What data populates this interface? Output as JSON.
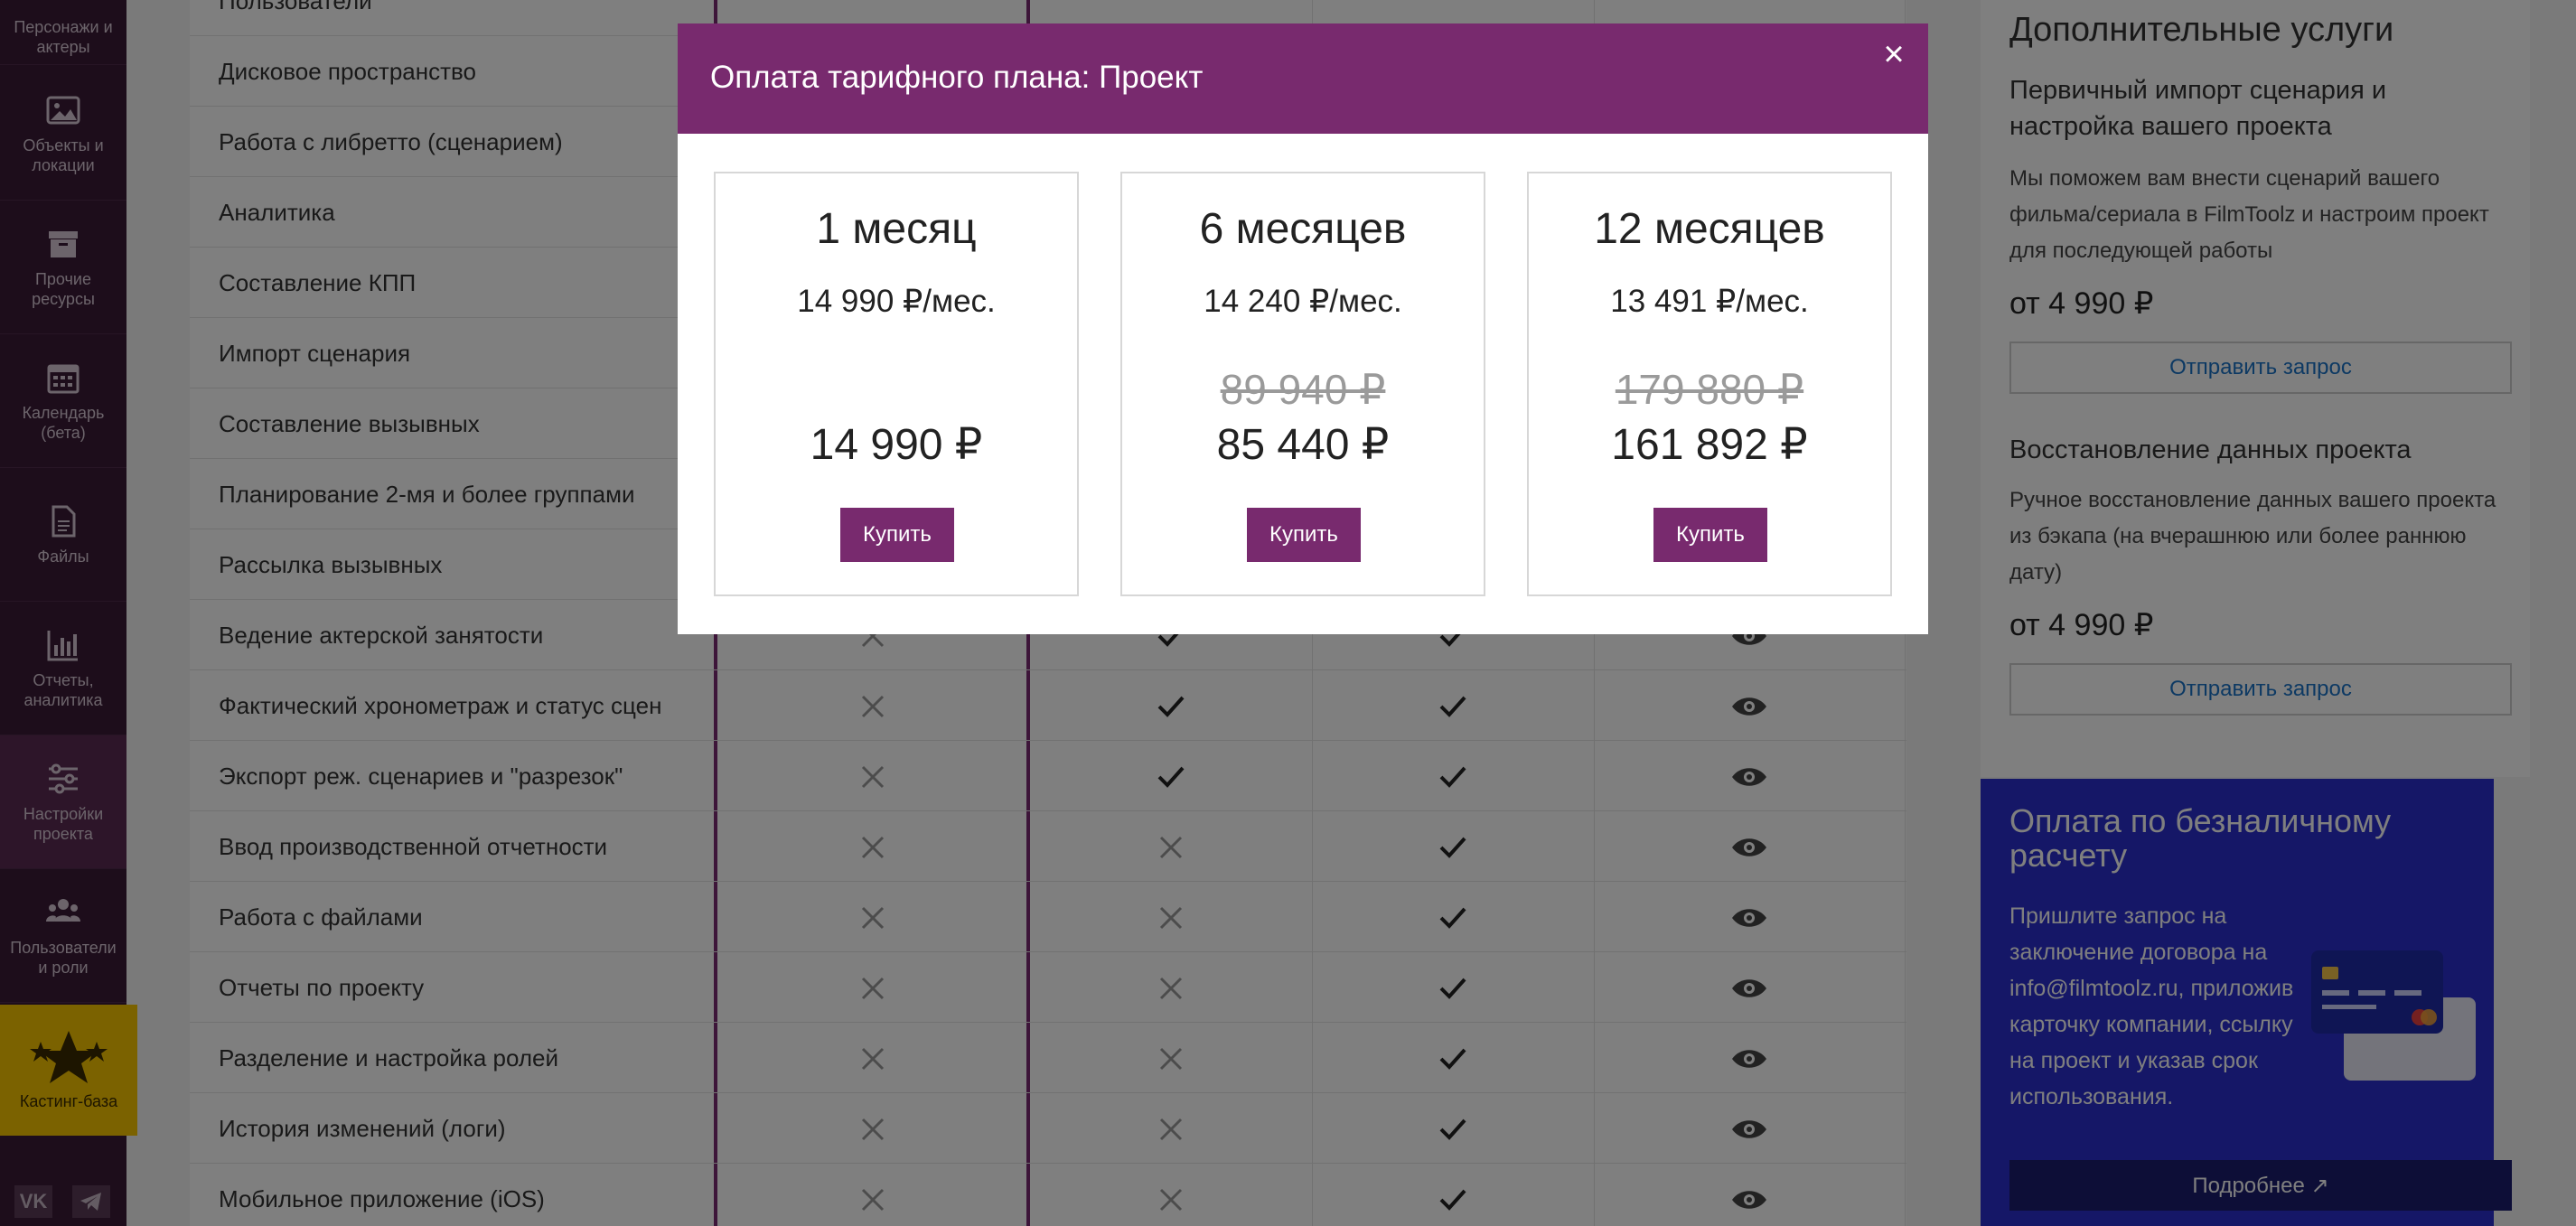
{
  "sidebar": {
    "items": [
      {
        "label": "Персонажи и актеры",
        "icon": "people-icon"
      },
      {
        "label": "Объекты и локации",
        "icon": "image-icon"
      },
      {
        "label": "Прочие ресурсы",
        "icon": "box-icon"
      },
      {
        "label": "Календарь (бета)",
        "icon": "calendar-icon"
      },
      {
        "label": "Файлы",
        "icon": "file-icon"
      },
      {
        "label": "Отчеты, аналитика",
        "icon": "bar-chart-icon"
      },
      {
        "label": "Настройки проекта",
        "icon": "sliders-icon"
      },
      {
        "label": "Пользователи и роли",
        "icon": "users-icon"
      }
    ],
    "casting": {
      "label": "Кастинг-база",
      "icon": "stars-icon"
    },
    "social": [
      "vk-icon",
      "telegram-icon"
    ]
  },
  "features": [
    {
      "name": "Пользователи",
      "cells": [
        "",
        "",
        "",
        ""
      ]
    },
    {
      "name": "Дисковое пространство",
      "cells": [
        "",
        "",
        "",
        ""
      ]
    },
    {
      "name": "Работа с либретто (сценарием)",
      "cells": [
        "",
        "",
        "",
        ""
      ]
    },
    {
      "name": "Аналитика",
      "cells": [
        "",
        "",
        "",
        ""
      ]
    },
    {
      "name": "Составление КПП",
      "cells": [
        "",
        "",
        "",
        ""
      ]
    },
    {
      "name": "Импорт сценария",
      "cells": [
        "",
        "",
        "",
        ""
      ]
    },
    {
      "name": "Составление вызывных",
      "cells": [
        "",
        "",
        "",
        ""
      ]
    },
    {
      "name": "Планирование 2-мя и более группами",
      "cells": [
        "",
        "",
        "",
        ""
      ]
    },
    {
      "name": "Рассылка вызывных",
      "cells": [
        "",
        "",
        "",
        ""
      ]
    },
    {
      "name": "Ведение актерской занятости",
      "cells": [
        "cross",
        "check",
        "check",
        "eye"
      ]
    },
    {
      "name": "Фактический хронометраж и статус сцен",
      "cells": [
        "cross",
        "check",
        "check",
        "eye"
      ]
    },
    {
      "name": "Экспорт реж. сценариев и \"разрезок\"",
      "cells": [
        "cross",
        "check",
        "check",
        "eye"
      ]
    },
    {
      "name": "Ввод производственной отчетности",
      "cells": [
        "cross",
        "cross",
        "check",
        "eye"
      ]
    },
    {
      "name": "Работа с файлами",
      "cells": [
        "cross",
        "cross",
        "check",
        "eye"
      ]
    },
    {
      "name": "Отчеты по проекту",
      "cells": [
        "cross",
        "cross",
        "check",
        "eye"
      ]
    },
    {
      "name": "Разделение и настройка ролей",
      "cells": [
        "cross",
        "cross",
        "check",
        "eye"
      ]
    },
    {
      "name": "История изменений (логи)",
      "cells": [
        "cross",
        "cross",
        "check",
        "eye"
      ]
    },
    {
      "name": "Мобильное приложение (iOS)",
      "cells": [
        "cross",
        "cross",
        "check",
        "eye"
      ]
    }
  ],
  "right_panel": {
    "title": "Дополнительные услуги",
    "services": [
      {
        "title": "Первичный импорт сценария и настройка вашего проекта",
        "text": "Мы поможем вам внести сценарий вашего фильма/сериала в FilmToolz и настроим проект для последующей работы",
        "price": "от 4 990 ₽",
        "button": "Отправить запрос"
      },
      {
        "title": "Восстановление данных проекта",
        "text": "Ручное восстановление данных вашего проекта из бэкапа (на вчерашнюю или более раннюю дату)",
        "price": "от 4 990 ₽",
        "button": "Отправить запрос"
      }
    ],
    "bank": {
      "title": "Оплата по безналичному расчету",
      "text": "Пришлите запрос на заключение договора на info@filmtoolz.ru, приложив карточку компании, ссылку на проект и указав срок использования.",
      "button": "Подробнее ↗",
      "color": "#2b2fcf"
    }
  },
  "modal": {
    "title": "Оплата тарифного плана: Проект",
    "close": "×",
    "accent": "#782a6e",
    "plans": [
      {
        "period": "1 месяц",
        "monthly": "14 990 ₽/мес.",
        "old_total": "",
        "total": "14 990 ₽",
        "buy": "Купить"
      },
      {
        "period": "6 месяцев",
        "monthly": "14 240 ₽/мес.",
        "old_total": "89 940 ₽",
        "total": "85 440 ₽",
        "buy": "Купить"
      },
      {
        "period": "12 месяцев",
        "monthly": "13 491 ₽/мес.",
        "old_total": "179 880 ₽",
        "total": "161 892 ₽",
        "buy": "Купить"
      }
    ]
  }
}
